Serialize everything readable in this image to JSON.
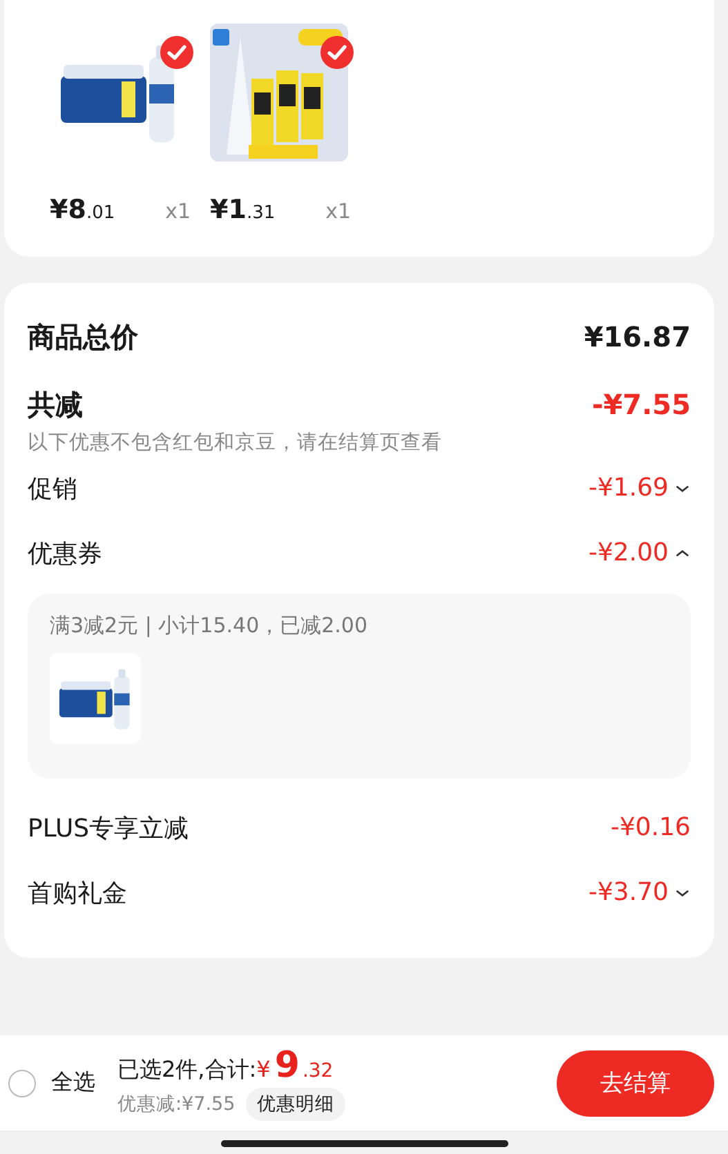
{
  "products": [
    {
      "kind": "water",
      "price": "¥8",
      "price_decimal": ".01",
      "quantity": "x1",
      "checked": true
    },
    {
      "kind": "glue",
      "price": "¥1",
      "price_decimal": ".31",
      "quantity": "x1",
      "checked": true
    }
  ],
  "summary": {
    "total": {
      "label": "商品总价",
      "value": "¥16.87"
    },
    "reduction": {
      "label": "共减",
      "value": "-¥7.55",
      "note": "以下优惠不包含红包和京豆，请在结算页查看"
    },
    "items": [
      {
        "kind": "collapsible",
        "label": "促销",
        "value": "-¥1.69",
        "expanded": false
      },
      {
        "kind": "collapsible",
        "label": "优惠券",
        "value": "-¥2.00",
        "expanded": true,
        "detail": {
          "text": "满3减2元 | 小计15.40，已减2.00",
          "products": [
            {
              "kind": "water"
            }
          ]
        }
      },
      {
        "kind": "plain",
        "label": "PLUS专享立减",
        "value": "-¥0.16"
      },
      {
        "kind": "collapsible",
        "label": "首购礼金",
        "value": "-¥3.70",
        "expanded": false
      }
    ]
  },
  "bottom_bar": {
    "select_all": {
      "label": "全选",
      "checked": false
    },
    "selected_text": "已选2件,合计:",
    "currency": "¥",
    "total_main": "9",
    "total_decimal": ".32",
    "discount": "优惠减:¥7.55",
    "detail_button": "优惠明细",
    "checkout_button": "去结算"
  }
}
